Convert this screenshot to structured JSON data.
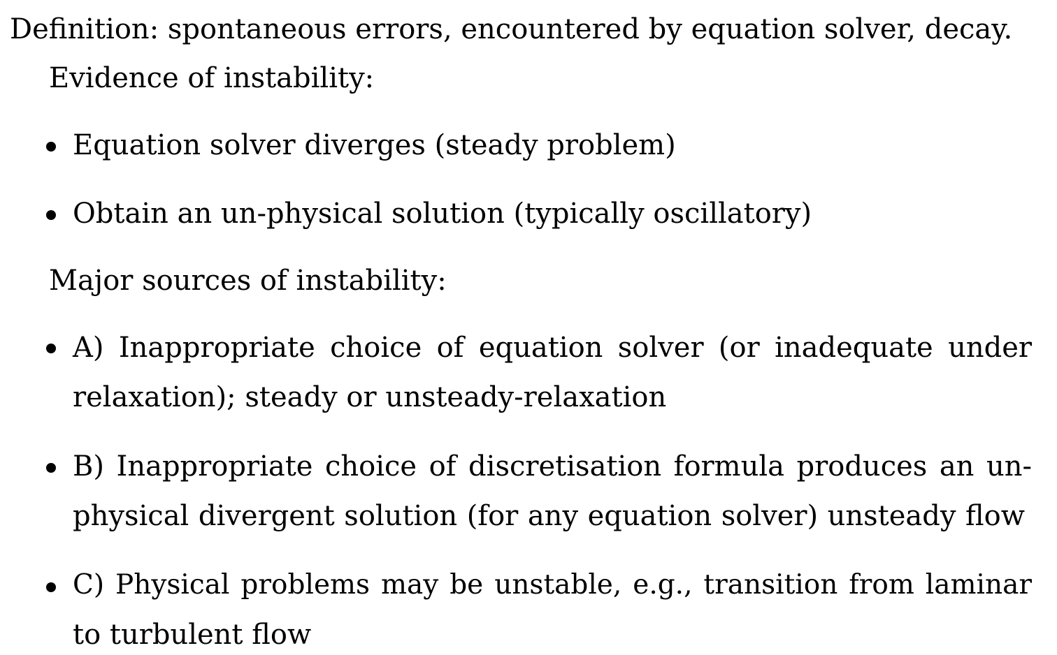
{
  "definition": "Definition: spontaneous errors, encountered by equation solver, decay.",
  "evidence": {
    "heading": "Evidence of instability:",
    "items": [
      "Equation solver diverges (steady problem)",
      "Obtain an un-physical solution (typically oscillatory)"
    ]
  },
  "sources": {
    "heading": "Major sources of instability:",
    "items": [
      {
        "line1": "A) Inappropriate choice of equation solver (or inadequate under",
        "line2": "relaxation); steady or unsteady-relaxation"
      },
      {
        "line1": "B) Inappropriate choice of discretisation formula produces an un-",
        "line2": "physical divergent solution (for any equation solver) unsteady flow"
      },
      {
        "line1": "C) Physical problems may be unstable, e.g., transition from laminar",
        "line2": "to turbulent flow"
      }
    ]
  }
}
